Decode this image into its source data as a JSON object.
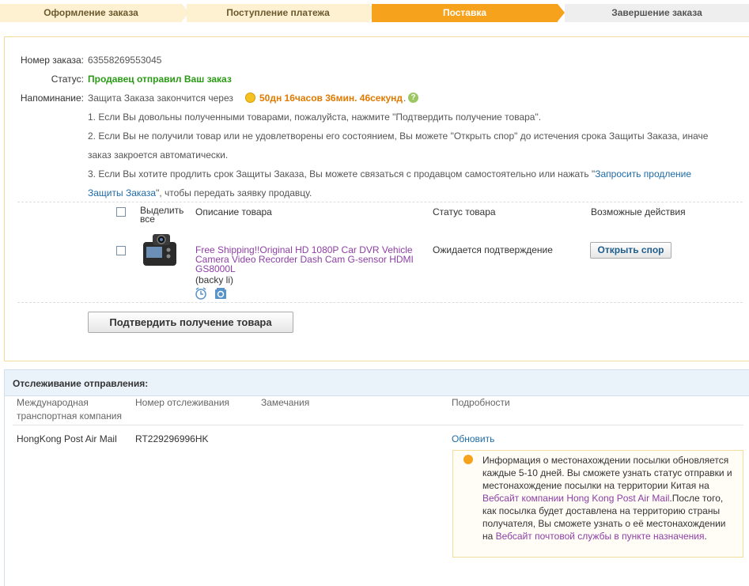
{
  "steps": [
    {
      "label": "Оформление заказа"
    },
    {
      "label": "Поступление платежа"
    },
    {
      "label": "Поставка"
    },
    {
      "label": "Завершение заказа"
    }
  ],
  "order": {
    "number_label": "Номер заказа:",
    "number": "63558269553045",
    "status_label": "Статус:",
    "status": "Продавец отправил Ваш заказ",
    "reminder_label": "Напоминание:",
    "reminder_text": "Защита Заказа закончится через",
    "countdown": "50дн 16часов 36мин. 46секунд",
    "reminder_end": ".",
    "note1": "1. Если Вы довольны полученными товарами, пожалуйста, нажмите \"Подтвердить получение товара\".",
    "note2a": "2. Если Вы не получили товар или не удовлетворены его состоянием, Вы можете \"Открыть спор\" до истечения срока Защиты Заказа, иначе",
    "note2b": "заказ закроется автоматически.",
    "note3a": "3. Если Вы хотите продлить срок Защиты Заказа, Вы можете связаться с продавцом самостоятельно или нажать \"",
    "note3_link1": "Запросить продление",
    "note3_link2": "Защиты Заказа",
    "note3_end": "\", чтобы передать заявку продавцу."
  },
  "table": {
    "select_all": "Выделить все",
    "col_description": "Описание товара",
    "col_status": "Статус товара",
    "col_actions": "Возможные действия"
  },
  "product": {
    "title": "Free Shipping!!Original HD 1080P Car DVR Vehicle Camera Video Recorder Dash Cam G-sensor HDMI GS8000L",
    "seller": "(backy li)",
    "status": "Ожидается подтверждение",
    "action": "Открыть спор"
  },
  "confirm_button": "Подтвердить получение товара",
  "tracking": {
    "title": "Отслеживание отправления:",
    "col_company": "Международная транспортная компания",
    "col_number": "Номер отслеживания",
    "col_remarks": "Замечания",
    "col_details": "Подробности",
    "company": "HongKong Post Air Mail",
    "number": "RT229296996HK",
    "remarks": "",
    "refresh": "Обновить",
    "info_a": "Информация о местонахождении посылки обновляется каждые 5-10 дней. Вы сможете узнать статус отправки и местонахождение посылки на территории Китая на ",
    "info_link1": "Вебсайт компании Hong Kong Post Air Mail",
    "info_b": ".После того, как посылка будет доставлена на территорию страны получателя, Вы сможете узнать о её местонахождении на ",
    "info_link2": "Вебсайт почтовой службы в пункте назначения",
    "info_c": "."
  },
  "colors": {
    "step_active": "#f7a21d",
    "step_done": "#fdf1d2",
    "status_green": "#2a9b15",
    "countdown_orange": "#e07a00",
    "link_blue": "#1e6ba8",
    "link_purple": "#8e3fa5"
  },
  "icons": [
    "clock-icon",
    "help-icon",
    "alarm-icon",
    "refresh-icon",
    "bulb-icon"
  ]
}
